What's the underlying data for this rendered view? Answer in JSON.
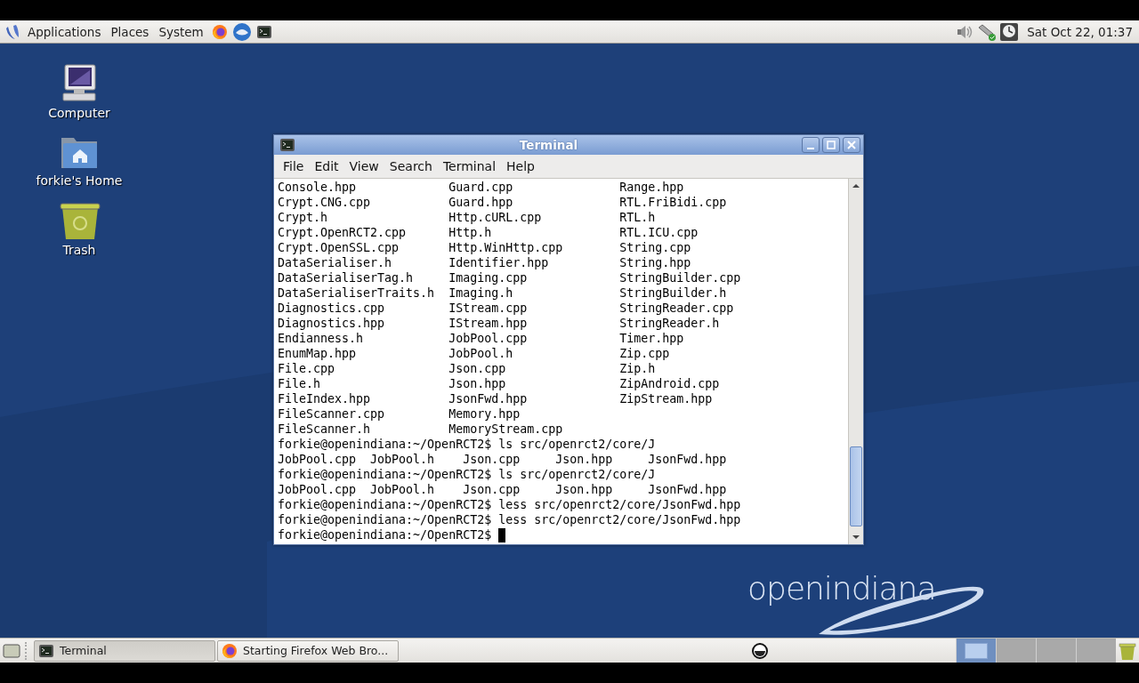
{
  "top_panel": {
    "menus": [
      {
        "label": "Applications"
      },
      {
        "label": "Places"
      },
      {
        "label": "System"
      }
    ],
    "clock": "Sat Oct 22, 01:37"
  },
  "desktop_icons": [
    {
      "label": "Computer",
      "kind": "computer"
    },
    {
      "label": "forkie's Home",
      "kind": "home"
    },
    {
      "label": "Trash",
      "kind": "trash"
    }
  ],
  "terminal": {
    "title": "Terminal",
    "menus": [
      "File",
      "Edit",
      "View",
      "Search",
      "Terminal",
      "Help"
    ],
    "lines": [
      "Console.hpp             Guard.cpp               Range.hpp",
      "Crypt.CNG.cpp           Guard.hpp               RTL.FriBidi.cpp",
      "Crypt.h                 Http.cURL.cpp           RTL.h",
      "Crypt.OpenRCT2.cpp      Http.h                  RTL.ICU.cpp",
      "Crypt.OpenSSL.cpp       Http.WinHttp.cpp        String.cpp",
      "DataSerialiser.h        Identifier.hpp          String.hpp",
      "DataSerialiserTag.h     Imaging.cpp             StringBuilder.cpp",
      "DataSerialiserTraits.h  Imaging.h               StringBuilder.h",
      "Diagnostics.cpp         IStream.cpp             StringReader.cpp",
      "Diagnostics.hpp         IStream.hpp             StringReader.h",
      "Endianness.h            JobPool.cpp             Timer.hpp",
      "EnumMap.hpp             JobPool.h               Zip.cpp",
      "File.cpp                Json.cpp                Zip.h",
      "File.h                  Json.hpp                ZipAndroid.cpp",
      "FileIndex.hpp           JsonFwd.hpp             ZipStream.hpp",
      "FileScanner.cpp         Memory.hpp",
      "FileScanner.h           MemoryStream.cpp",
      "forkie@openindiana:~/OpenRCT2$ ls src/openrct2/core/J",
      "JobPool.cpp  JobPool.h    Json.cpp     Json.hpp     JsonFwd.hpp",
      "forkie@openindiana:~/OpenRCT2$ ls src/openrct2/core/J",
      "JobPool.cpp  JobPool.h    Json.cpp     Json.hpp     JsonFwd.hpp",
      "forkie@openindiana:~/OpenRCT2$ less src/openrct2/core/JsonFwd.hpp",
      "forkie@openindiana:~/OpenRCT2$ less src/openrct2/core/JsonFwd.hpp"
    ],
    "prompt": "forkie@openindiana:~/OpenRCT2$"
  },
  "logo": "openindiana",
  "taskbar": {
    "windows": [
      {
        "label": "Terminal",
        "kind": "terminal",
        "selected": true
      },
      {
        "label": "Starting Firefox Web Bro...",
        "kind": "firefox",
        "selected": false
      }
    ],
    "workspaces": [
      {
        "selected": true
      },
      {
        "selected": false
      },
      {
        "selected": false
      },
      {
        "selected": false
      }
    ]
  }
}
